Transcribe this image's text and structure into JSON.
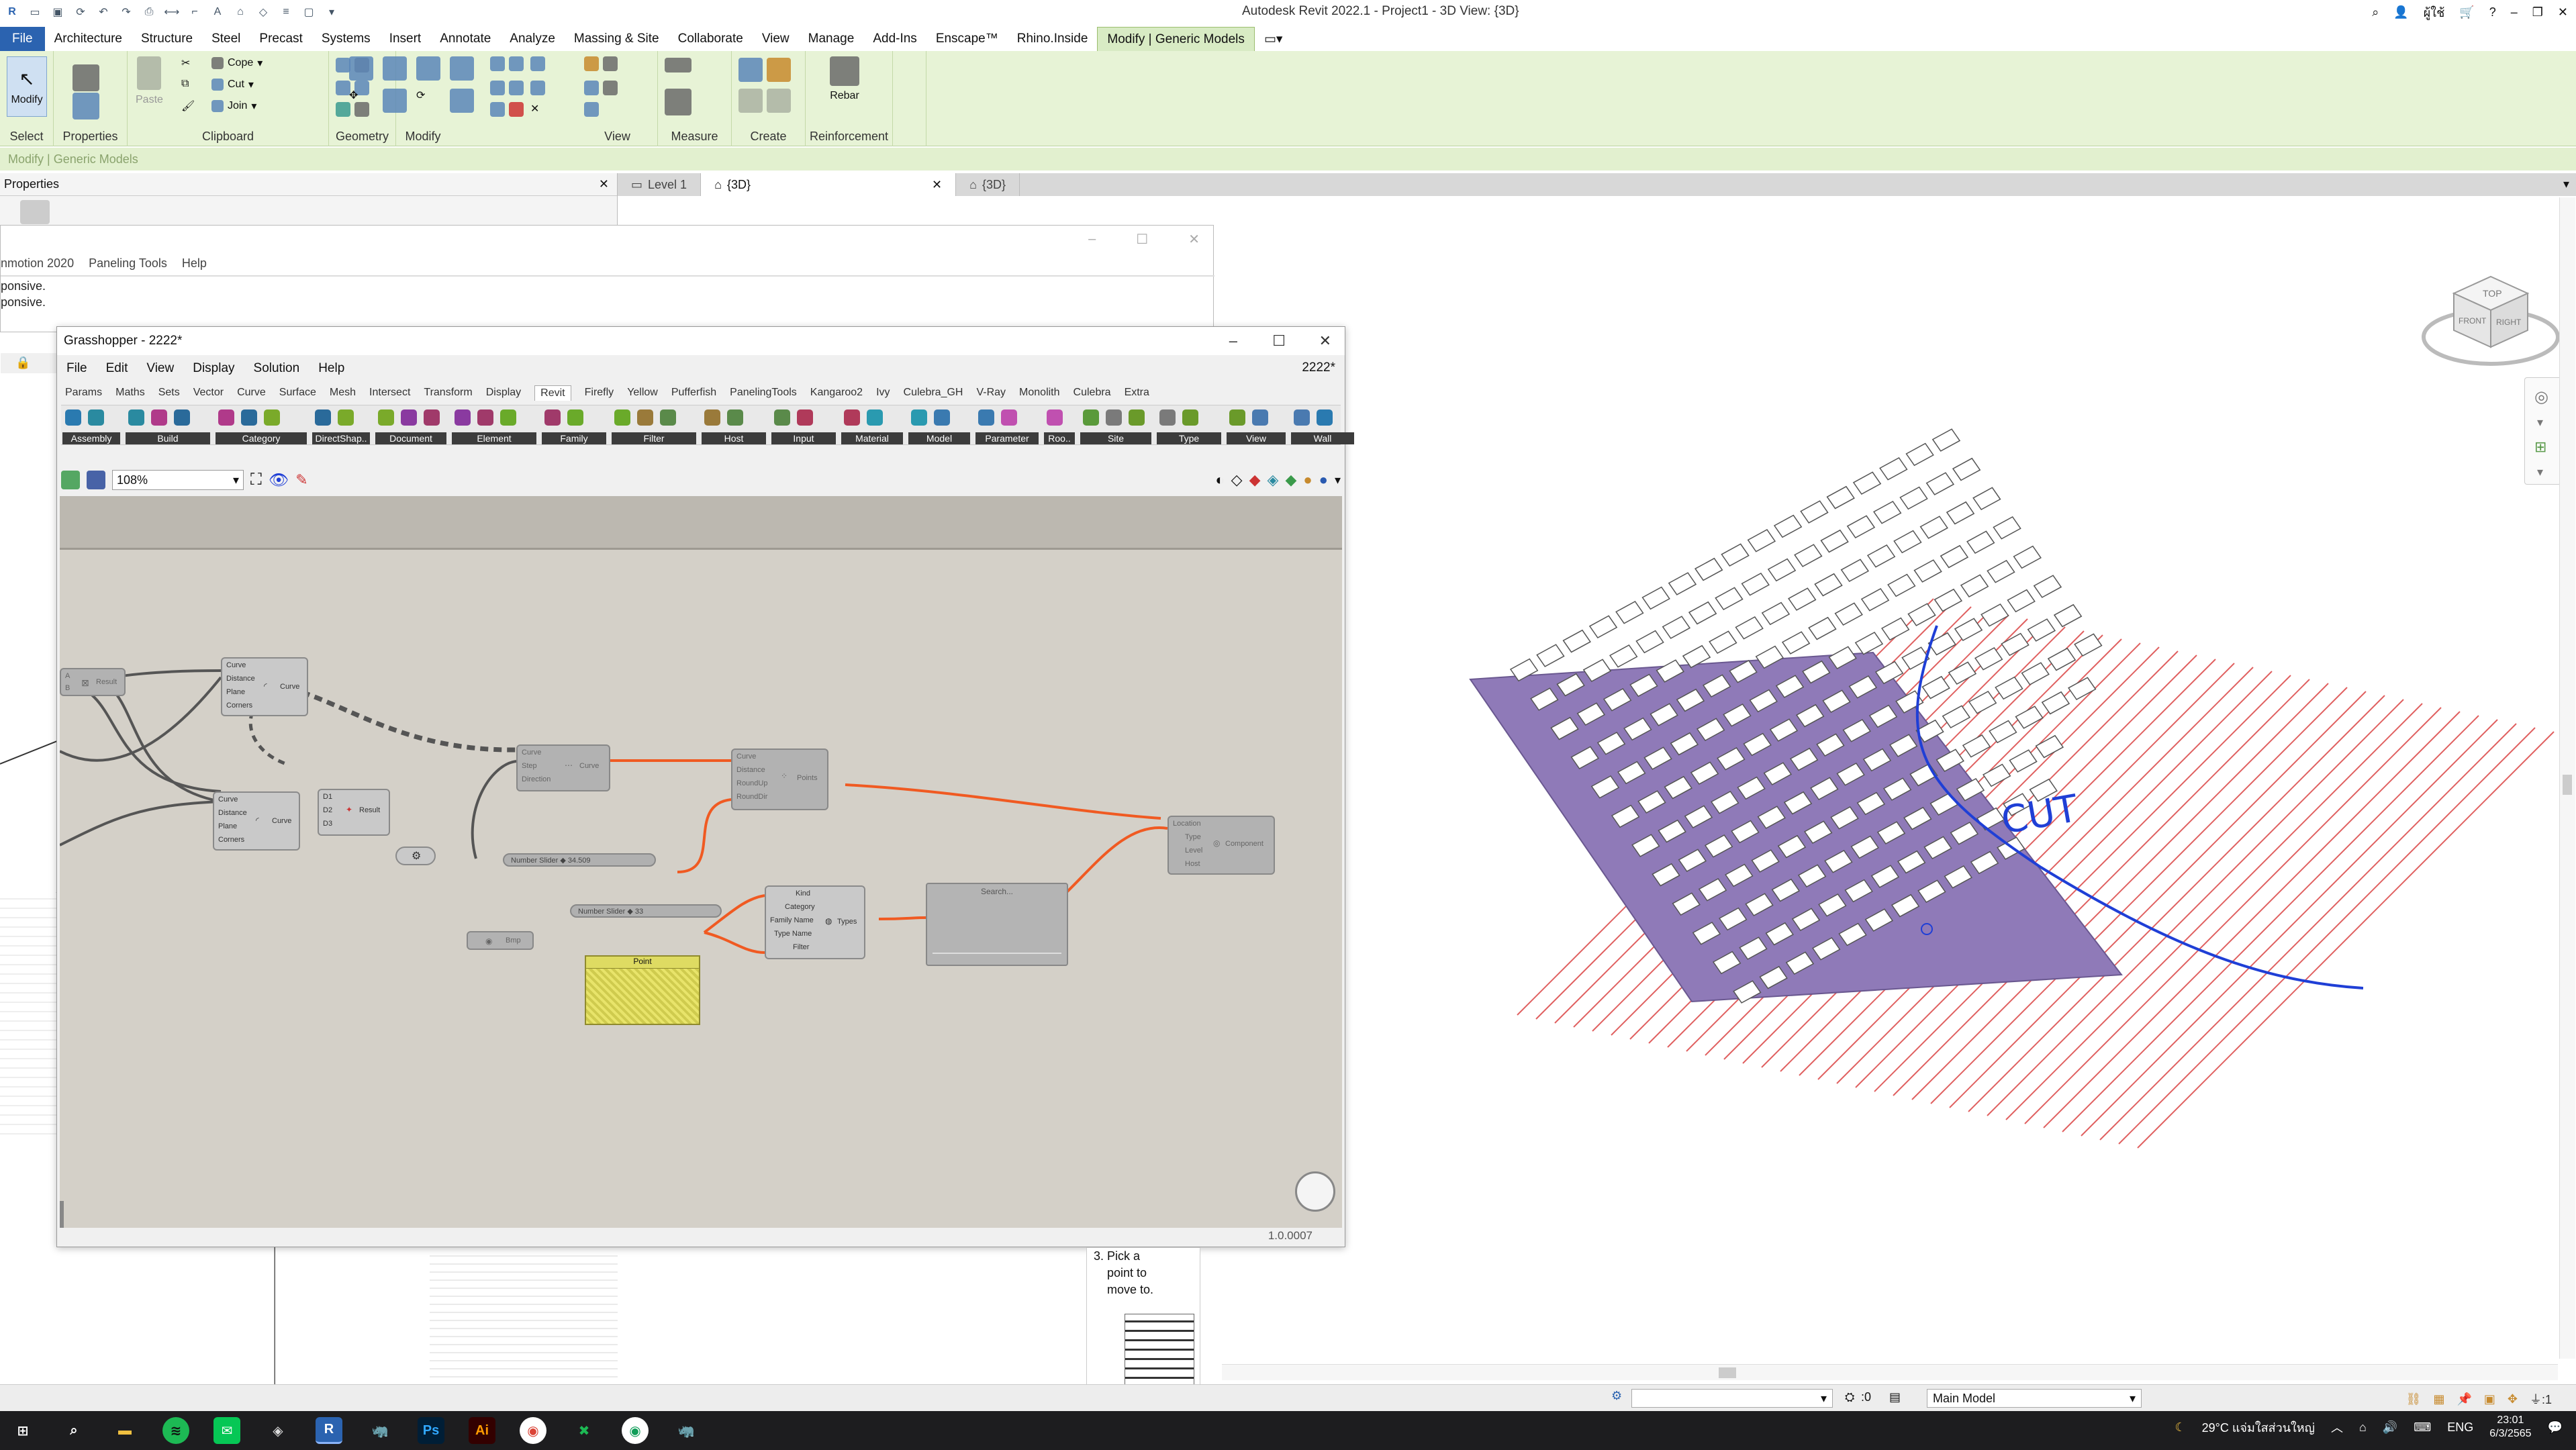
{
  "revit": {
    "title": "Autodesk Revit 2022.1 - Project1 - 3D View: {3D}",
    "user": "ผู้ใช้",
    "menu_tabs": [
      "File",
      "Architecture",
      "Structure",
      "Steel",
      "Precast",
      "Systems",
      "Insert",
      "Annotate",
      "Analyze",
      "Massing & Site",
      "Collaborate",
      "View",
      "Manage",
      "Add-Ins",
      "Enscape™",
      "Rhino.Inside",
      "Modify | Generic Models"
    ],
    "ribbon_groups": [
      "Select",
      "Properties",
      "Clipboard",
      "Geometry",
      "Modify",
      "View",
      "Measure",
      "Create",
      "Reinforcement"
    ],
    "ribbon_buttons": {
      "modify": "Modify",
      "paste": "Paste",
      "cope": "Cope",
      "cut": "Cut",
      "join": "Join",
      "rebar": "Rebar"
    },
    "context_bar": "Modify | Generic Models",
    "properties_title": "Properties",
    "view_tabs": [
      "Level 1",
      "{3D}",
      "{3D}"
    ],
    "viewcube": {
      "top": "TOP",
      "front": "FRONT",
      "right": "RIGHT"
    },
    "help_steps": [
      "3. Pick a",
      "point to",
      "move to."
    ],
    "status_model": "Main Model",
    "status_zero": ":0"
  },
  "rhino": {
    "menus": [
      "nmotion 2020",
      "Paneling Tools",
      "Help"
    ],
    "lines": [
      "ponsive.",
      "ponsive."
    ]
  },
  "grasshopper": {
    "title": "Grasshopper - 2222*",
    "doc": "2222*",
    "menus": [
      "File",
      "Edit",
      "View",
      "Display",
      "Solution",
      "Help"
    ],
    "tabs": [
      "Params",
      "Maths",
      "Sets",
      "Vector",
      "Curve",
      "Surface",
      "Mesh",
      "Intersect",
      "Transform",
      "Display",
      "Revit",
      "Firefly",
      "Yellow",
      "Pufferfish",
      "PanelingTools",
      "Kangaroo2",
      "Ivy",
      "Culebra_GH",
      "V-Ray",
      "Monolith",
      "Culebra",
      "Extra"
    ],
    "active_tab": "Revit",
    "component_groups": [
      "Assembly",
      "Build",
      "Category",
      "DirectShap..",
      "Document",
      "Element",
      "Family",
      "Filter",
      "Host",
      "Input",
      "Material",
      "Model",
      "Parameter",
      "Roo..",
      "Site",
      "Type",
      "View",
      "Wall"
    ],
    "zoom": "108%",
    "version": "1.0.0007",
    "nodes": {
      "offset1": {
        "inputs": [
          "Curve",
          "Distance",
          "Plane",
          "Corners"
        ],
        "output": "Curve"
      },
      "offset2": {
        "inputs": [
          "Curve",
          "Distance",
          "Plane",
          "Corners"
        ],
        "output": "Curve"
      },
      "result1": {
        "output": "Result"
      },
      "result2": {
        "inputs": [
          "D1",
          "D2",
          "D3"
        ],
        "output": "Result"
      },
      "divide": {
        "inputs": [
          "Curve",
          "Step",
          "Direction"
        ],
        "output": "Curve"
      },
      "points": {
        "inputs": [
          "Curve",
          "Distance",
          "RoundUp",
          "RoundDir"
        ],
        "output": "Points"
      },
      "slider1": "Number Slider ◆ 34.509",
      "slider2": "Number Slider ◆ 33",
      "toggle": "Bmp",
      "panel": "Point",
      "types": {
        "inputs": [
          "Kind",
          "Category",
          "Family Name",
          "Type Name",
          "Filter"
        ],
        "output": "Types"
      },
      "search": "Search...",
      "add": {
        "inputs": [
          "Location",
          "Type",
          "Level",
          "Host"
        ],
        "output": "Component"
      }
    }
  },
  "annotation": "CUT",
  "taskbar": {
    "weather": "29°C แจ่มใสส่วนใหญ่",
    "lang": "ENG",
    "time": "23:01",
    "date": "6/3/2565"
  },
  "colors": {
    "revit_blue": "#2b63b0",
    "ribbon_green": "#e7f3d6",
    "panel_purple": "#8f7ab8",
    "section_red": "#e06060",
    "curve_blue": "#1f3fd6",
    "wire_orange": "#f05a22"
  }
}
